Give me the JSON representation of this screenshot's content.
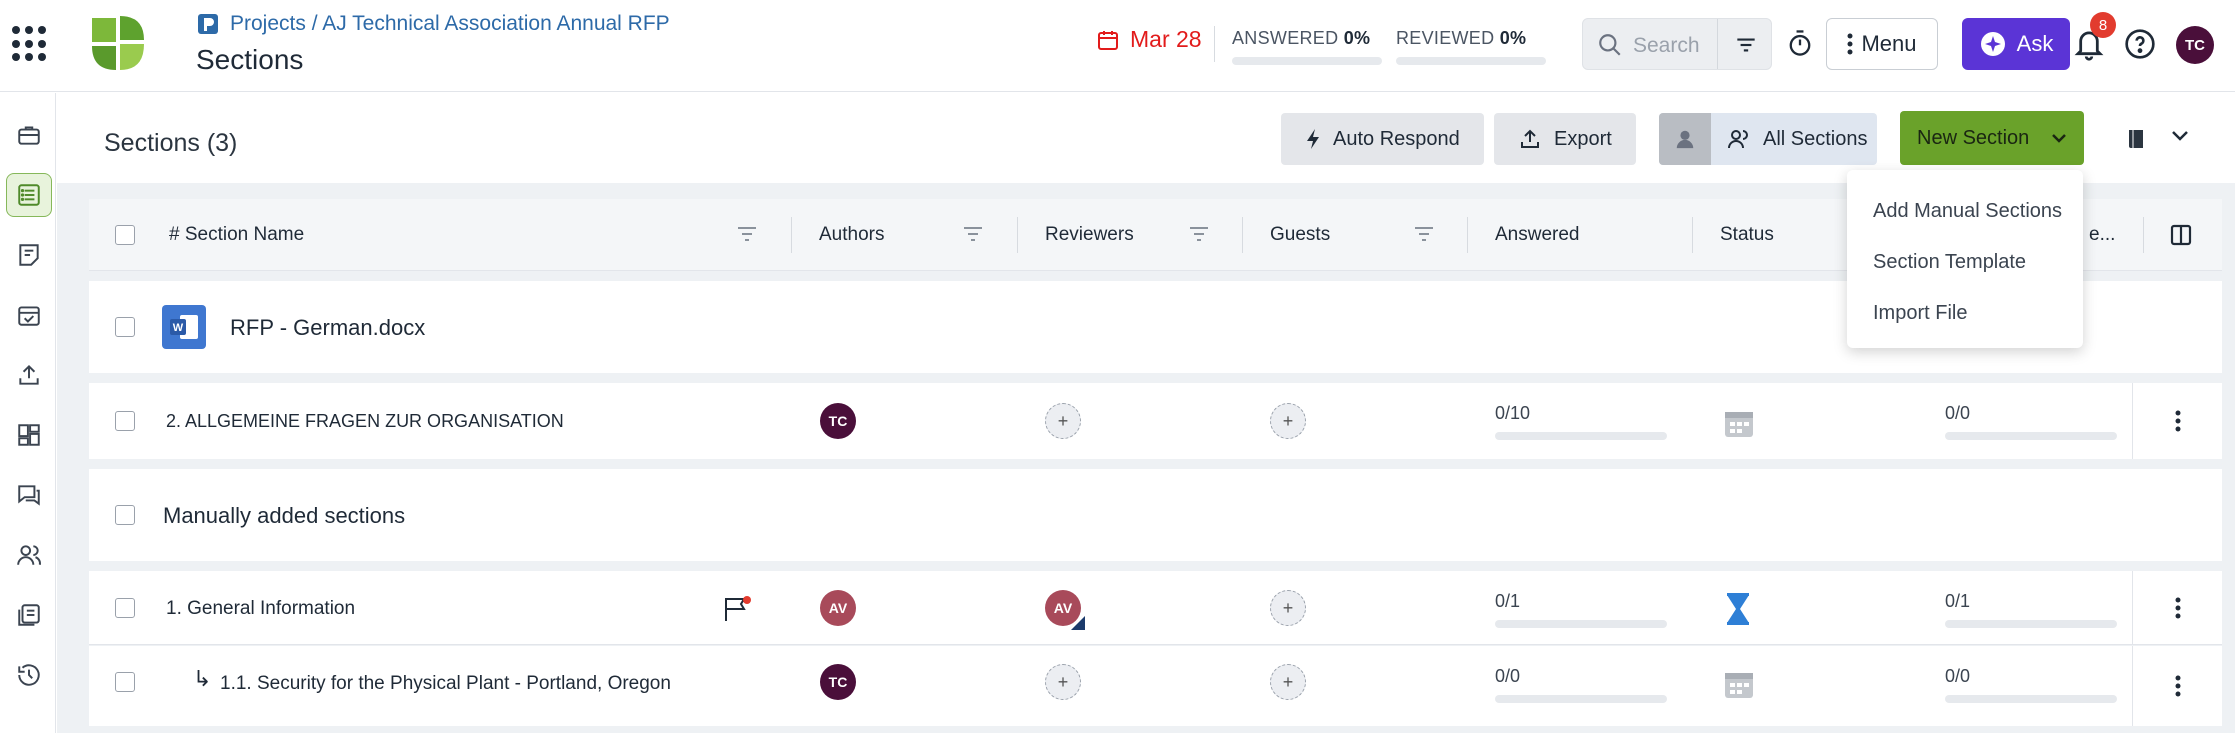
{
  "header": {
    "breadcrumb": "Projects / AJ Technical Association Annual RFP",
    "title": "Sections",
    "due_date": "Mar 28",
    "answered_label": "ANSWERED",
    "answered_value": "0%",
    "reviewed_label": "REVIEWED",
    "reviewed_value": "0%",
    "search_placeholder": "Search",
    "menu_label": "Menu",
    "ask_label": "Ask",
    "notification_count": "8",
    "user_initials": "TC"
  },
  "sidebar": {
    "items": [
      "briefcase-icon",
      "list-icon",
      "notes-icon",
      "calendar-check-icon",
      "upload-icon",
      "dashboard-icon",
      "chat-icon",
      "users-icon",
      "library-icon",
      "history-icon"
    ],
    "active": "list-icon"
  },
  "toolbar": {
    "sections_title": "Sections (3)",
    "auto_respond": "Auto Respond",
    "export": "Export",
    "all_sections": "All Sections",
    "new_section": "New Section"
  },
  "dropdown": {
    "items": [
      "Add Manual Sections",
      "Section Template",
      "Import File"
    ]
  },
  "table": {
    "columns": {
      "section_name": "# Section Name",
      "authors": "Authors",
      "reviewers": "Reviewers",
      "guests": "Guests",
      "answered": "Answered",
      "status": "Status",
      "reviewed_truncated": "e..."
    },
    "group_doc": "RFP - German.docx",
    "row_1": {
      "name": "2. ALLGEMEINE FRAGEN ZUR ORGANISATION",
      "author": "TC",
      "answered": "0/10",
      "reviewed": "0/0"
    },
    "group_manual": "Manually added sections",
    "row_2": {
      "name": "1. General Information",
      "author": "AV",
      "reviewer": "AV",
      "answered": "0/1",
      "reviewed": "0/1"
    },
    "row_3": {
      "arrow": "↳",
      "name": "1.1. Security for the Physical Plant - Portland, Oregon",
      "author": "TC",
      "answered": "0/0",
      "reviewed": "0/0"
    }
  },
  "colors": {
    "accent_green": "#6aa22a",
    "ask_purple": "#5b34d6",
    "due_red": "#e21b1b",
    "link_blue": "#2d6aa8",
    "avatar_tc": "#4a0f3a",
    "avatar_av": "#a84a5a"
  }
}
